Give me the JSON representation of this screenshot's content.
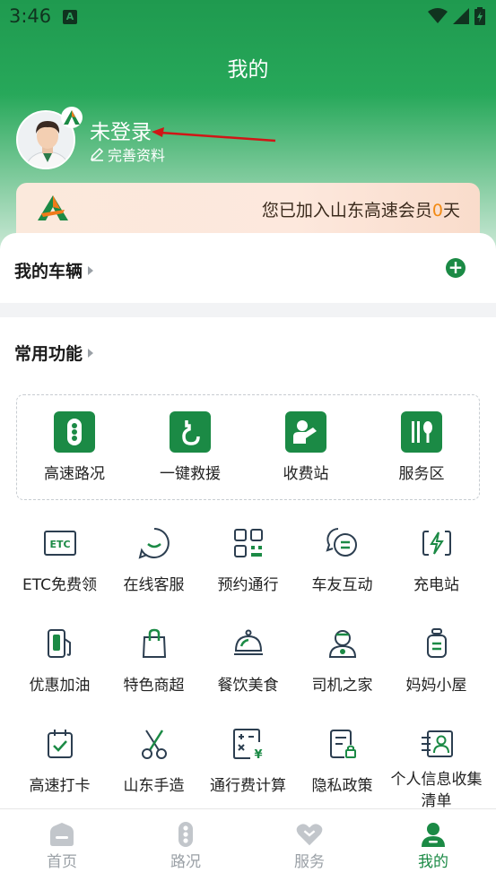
{
  "status_bar": {
    "time": "3:46",
    "app_badge": "A"
  },
  "header": {
    "title": "我的"
  },
  "profile": {
    "name": "未登录",
    "complete_label": "完善资料"
  },
  "member": {
    "prefix": "您已加入山东高速会员",
    "days": "0",
    "suffix": "天"
  },
  "vehicles": {
    "label": "我的车辆",
    "add": "+"
  },
  "common": {
    "label": "常用功能"
  },
  "featured": [
    {
      "label": "高速路况",
      "icon": "traffic-light-icon"
    },
    {
      "label": "一键救援",
      "icon": "rescue-hook-icon"
    },
    {
      "label": "收费站",
      "icon": "toll-station-icon"
    },
    {
      "label": "服务区",
      "icon": "service-area-icon"
    }
  ],
  "functions": [
    {
      "label": "ETC免费领",
      "icon": "etc-card-icon"
    },
    {
      "label": "在线客服",
      "icon": "chat-smile-icon"
    },
    {
      "label": "预约通行",
      "icon": "qr-code-icon"
    },
    {
      "label": "车友互动",
      "icon": "chat-bubbles-icon"
    },
    {
      "label": "充电站",
      "icon": "charging-icon"
    },
    {
      "label": "优惠加油",
      "icon": "fuel-pump-icon"
    },
    {
      "label": "特色商超",
      "icon": "shopping-bag-icon"
    },
    {
      "label": "餐饮美食",
      "icon": "food-cloche-icon"
    },
    {
      "label": "司机之家",
      "icon": "driver-home-icon"
    },
    {
      "label": "妈妈小屋",
      "icon": "baby-bottle-icon"
    },
    {
      "label": "高速打卡",
      "icon": "calendar-check-icon"
    },
    {
      "label": "山东手造",
      "icon": "scissors-icon"
    },
    {
      "label": "通行费计算",
      "icon": "calculator-icon"
    },
    {
      "label": "隐私政策",
      "icon": "privacy-doc-icon"
    },
    {
      "label": "个人信息收集清单",
      "icon": "personal-info-icon"
    }
  ],
  "tabs": [
    {
      "label": "首页",
      "icon": "home-icon",
      "active": false
    },
    {
      "label": "路况",
      "icon": "traffic-light-icon",
      "active": false
    },
    {
      "label": "服务",
      "icon": "heart-icon",
      "active": false
    },
    {
      "label": "我的",
      "icon": "user-icon",
      "active": true
    }
  ],
  "colors": {
    "primary": "#1b8a45",
    "header": "#27a85a",
    "accent_days": "#f28a14",
    "annotation_arrow": "#d01616"
  }
}
